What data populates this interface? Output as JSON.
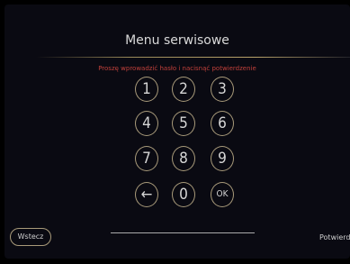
{
  "header": {
    "title": "Menu serwisowe"
  },
  "prompt": {
    "text": "Proszę wprowadzić hasło i nacisnąć potwierdzenie"
  },
  "keypad": {
    "keys": [
      "1",
      "2",
      "3",
      "4",
      "5",
      "6",
      "7",
      "8",
      "9",
      "←",
      "0",
      "OK"
    ]
  },
  "footer": {
    "back_label": "Wstecz",
    "confirm_label": "Potwierdź"
  },
  "colors": {
    "accent_ring": "#a89a7a",
    "hint_red": "#c0403a"
  }
}
